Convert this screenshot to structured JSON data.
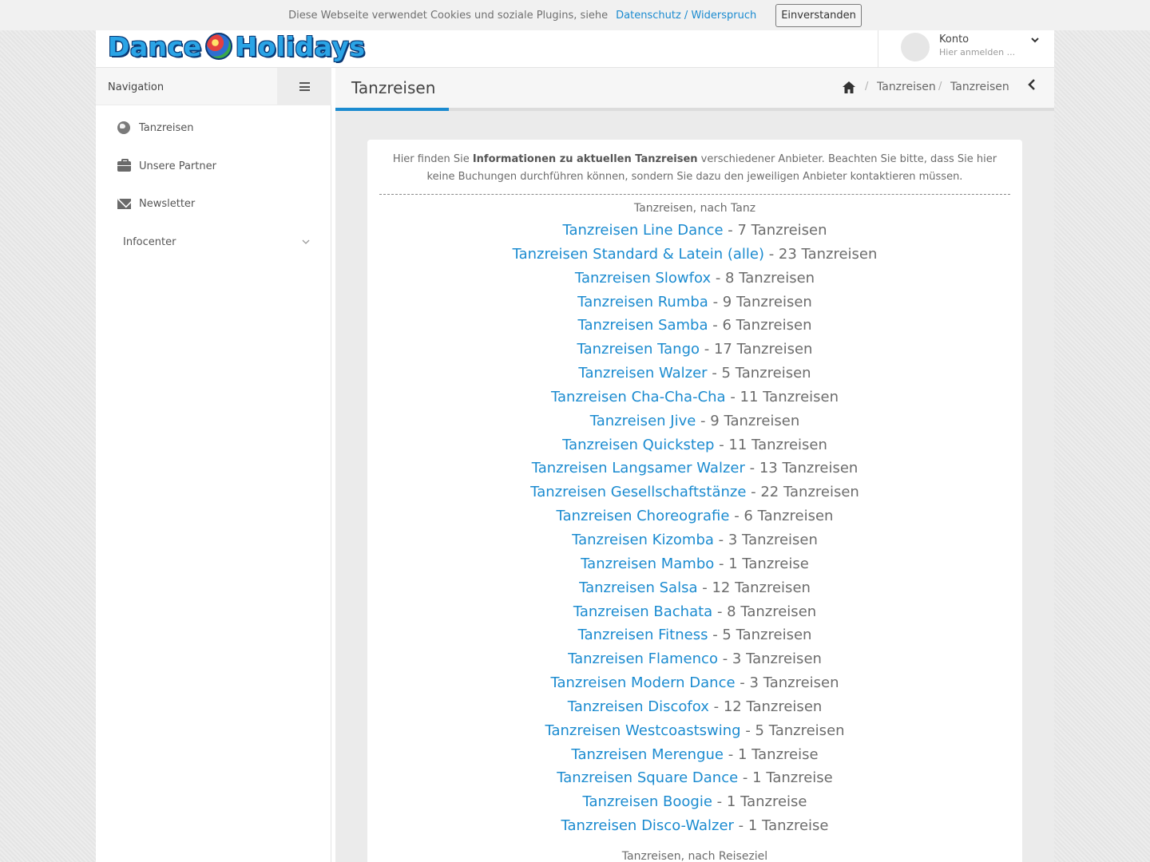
{
  "cookie": {
    "text": "Diese Webseite verwendet Cookies und soziale Plugins, siehe",
    "link": "Datenschutz / Widerspruch",
    "button": "Einverstanden"
  },
  "header": {
    "logo_left": "Dance",
    "logo_right": "Holidays",
    "account_title": "Konto",
    "account_sub": "Hier anmelden ..."
  },
  "sidebar": {
    "title": "Navigation",
    "items": [
      {
        "label": "Tanzreisen",
        "icon": "globe-icon"
      },
      {
        "label": "Unsere Partner",
        "icon": "briefcase-icon"
      },
      {
        "label": "Newsletter",
        "icon": "envelope-icon"
      },
      {
        "label": "Infocenter",
        "icon": "chevron-down-icon"
      }
    ]
  },
  "content": {
    "title": "Tanzreisen",
    "breadcrumb": [
      "Tanzreisen",
      "Tanzreisen"
    ],
    "intro_pre": "Hier finden Sie ",
    "intro_bold": "Informationen zu aktuellen Tanzreisen",
    "intro_post": " verschiedener Anbieter. Beachten Sie bitte, dass Sie hier keine Buchungen durchführen können, sondern Sie dazu den jeweiligen Anbieter kontaktieren müssen.",
    "section_dance": "Tanzreisen, nach Tanz",
    "section_destination": "Tanzreisen, nach Reiseziel",
    "dances": [
      {
        "name": "Tanzreisen Line Dance",
        "count": "- 7 Tanzreisen"
      },
      {
        "name": "Tanzreisen Standard & Latein (alle)",
        "count": "- 23 Tanzreisen"
      },
      {
        "name": "Tanzreisen Slowfox",
        "count": "- 8 Tanzreisen"
      },
      {
        "name": "Tanzreisen Rumba",
        "count": "- 9 Tanzreisen"
      },
      {
        "name": "Tanzreisen Samba",
        "count": "- 6 Tanzreisen"
      },
      {
        "name": "Tanzreisen Tango",
        "count": "- 17 Tanzreisen"
      },
      {
        "name": "Tanzreisen Walzer",
        "count": "- 5 Tanzreisen"
      },
      {
        "name": "Tanzreisen Cha-Cha-Cha",
        "count": "- 11 Tanzreisen"
      },
      {
        "name": "Tanzreisen Jive",
        "count": "- 9 Tanzreisen"
      },
      {
        "name": "Tanzreisen Quickstep",
        "count": "- 11 Tanzreisen"
      },
      {
        "name": "Tanzreisen Langsamer Walzer",
        "count": "- 13 Tanzreisen"
      },
      {
        "name": "Tanzreisen Gesellschaftstänze",
        "count": "- 22 Tanzreisen"
      },
      {
        "name": "Tanzreisen Choreografie",
        "count": "- 6 Tanzreisen"
      },
      {
        "name": "Tanzreisen Kizomba",
        "count": "- 3 Tanzreisen"
      },
      {
        "name": "Tanzreisen Mambo",
        "count": "- 1 Tanzreise"
      },
      {
        "name": "Tanzreisen Salsa",
        "count": "- 12 Tanzreisen"
      },
      {
        "name": "Tanzreisen Bachata",
        "count": "- 8 Tanzreisen"
      },
      {
        "name": "Tanzreisen Fitness",
        "count": "- 5 Tanzreisen"
      },
      {
        "name": "Tanzreisen Flamenco",
        "count": "- 3 Tanzreisen"
      },
      {
        "name": "Tanzreisen Modern Dance",
        "count": "- 3 Tanzreisen"
      },
      {
        "name": "Tanzreisen Discofox",
        "count": "- 12 Tanzreisen"
      },
      {
        "name": "Tanzreisen Westcoastswing",
        "count": "- 5 Tanzreisen"
      },
      {
        "name": "Tanzreisen Merengue",
        "count": "- 1 Tanzreise"
      },
      {
        "name": "Tanzreisen Square Dance",
        "count": "- 1 Tanzreise"
      },
      {
        "name": "Tanzreisen Boogie",
        "count": "- 1 Tanzreise"
      },
      {
        "name": "Tanzreisen Disco-Walzer",
        "count": "- 1 Tanzreise"
      }
    ]
  },
  "colors": {
    "accent": "#1b8bd0",
    "text": "#6c6c6c",
    "panel": "#f6f6f6"
  }
}
